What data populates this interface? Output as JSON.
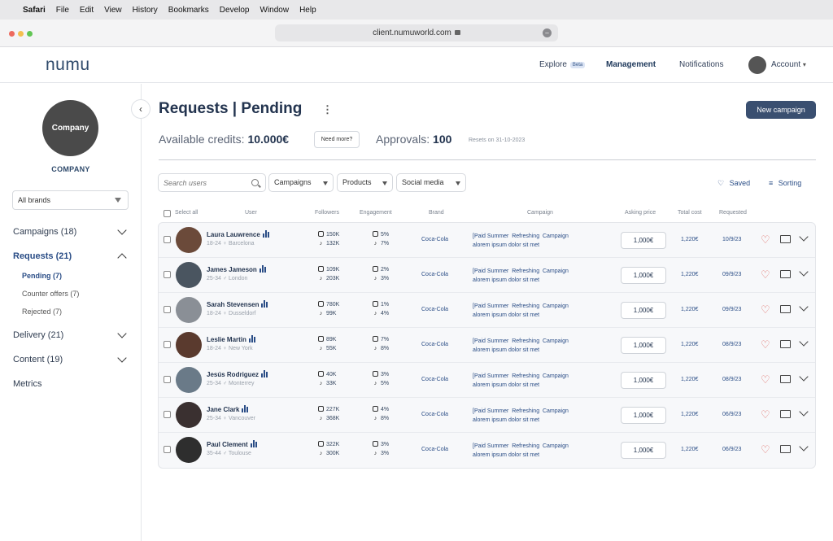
{
  "menubar": {
    "apple": "",
    "app": "Safari",
    "items": [
      "File",
      "Edit",
      "View",
      "History",
      "Bookmarks",
      "Develop",
      "Window",
      "Help"
    ]
  },
  "browser": {
    "url": "client.numuworld.com"
  },
  "topnav": {
    "logo": "numu",
    "explore": "Explore",
    "beta": "Beta",
    "management": "Management",
    "notifications": "Notifications",
    "account": "Account"
  },
  "sidebar": {
    "company_logo": "Company",
    "company_name": "COMPANY",
    "brand_select": "All brands",
    "campaigns": "Campaigns (18)",
    "requests": "Requests (21)",
    "pending": "Pending (7)",
    "counter_offers": "Counter offers (7)",
    "rejected": "Rejected (7)",
    "delivery": "Delivery (21)",
    "content": "Content (19)",
    "metrics": "Metrics"
  },
  "main": {
    "title": "Requests | Pending",
    "new_campaign": "New campaign",
    "credits_label": "Available credits:",
    "credits_value": "10.000€",
    "need_more": "Need more?",
    "approvals_label": "Approvals:",
    "approvals_value": "100",
    "resets": "Resets on 31-10-2023",
    "search_placeholder": "Search users",
    "filters": {
      "campaigns": "Campaigns",
      "products": "Products",
      "social": "Social media"
    },
    "saved": "Saved",
    "sorting": "Sorting"
  },
  "headers": {
    "select_all": "Select all",
    "user": "User",
    "followers": "Followers",
    "engagement": "Engagement",
    "brand": "Brand",
    "campaign": "Campaign",
    "asking_price": "Asking price",
    "total_cost": "Total cost",
    "requested": "Requested"
  },
  "rows": [
    {
      "name": "Laura Lauwrence",
      "meta": "18-24  ♀  Barcelona",
      "ig_f": "150K",
      "tk_f": "132K",
      "ig_e": "5%",
      "tk_e": "7%",
      "brand": "Coca-Cola",
      "camp1": "[Paid Summer  Refreshing  Campaign",
      "camp2": "alorem ipsum dolor sit met",
      "price": "1,000€",
      "total": "1,220€",
      "date": "10/9/23"
    },
    {
      "name": "James Jameson",
      "meta": "25-34  ♂  London",
      "ig_f": "109K",
      "tk_f": "203K",
      "ig_e": "2%",
      "tk_e": "3%",
      "brand": "Coca-Cola",
      "camp1": "[Paid Summer  Refreshing  Campaign",
      "camp2": "alorem ipsum dolor sit met",
      "price": "1,000€",
      "total": "1,220€",
      "date": "09/9/23"
    },
    {
      "name": "Sarah Stevensen",
      "meta": "18-24  ♀  Dusseldorf",
      "ig_f": "780K",
      "tk_f": "99K",
      "ig_e": "1%",
      "tk_e": "4%",
      "brand": "Coca-Cola",
      "camp1": "[Paid Summer  Refreshing  Campaign",
      "camp2": "alorem ipsum dolor sit met",
      "price": "1,000€",
      "total": "1,220€",
      "date": "09/9/23"
    },
    {
      "name": "Leslie Martin",
      "meta": "18-24  ♀  New York",
      "ig_f": "89K",
      "tk_f": "55K",
      "ig_e": "7%",
      "tk_e": "8%",
      "brand": "Coca-Cola",
      "camp1": "[Paid Summer  Refreshing  Campaign",
      "camp2": "alorem ipsum dolor sit met",
      "price": "1,000€",
      "total": "1,220€",
      "date": "08/9/23"
    },
    {
      "name": "Jesús Rodriguez",
      "meta": "25-34  ♂  Monterrey",
      "ig_f": "40K",
      "tk_f": "33K",
      "ig_e": "3%",
      "tk_e": "5%",
      "brand": "Coca-Cola",
      "camp1": "[Paid Summer  Refreshing  Campaign",
      "camp2": "alorem ipsum dolor sit met",
      "price": "1,000€",
      "total": "1,220€",
      "date": "08/9/23"
    },
    {
      "name": "Jane Clark",
      "meta": "25-34  ♀  Vancouver",
      "ig_f": "227K",
      "tk_f": "368K",
      "ig_e": "4%",
      "tk_e": "8%",
      "brand": "Coca-Cola",
      "camp1": "[Paid Summer  Refreshing  Campaign",
      "camp2": "alorem ipsum dolor sit met",
      "price": "1,000€",
      "total": "1,220€",
      "date": "06/9/23"
    },
    {
      "name": "Paul Clement",
      "meta": "35-44  ♂  Toulouse",
      "ig_f": "322K",
      "tk_f": "300K",
      "ig_e": "3%",
      "tk_e": "3%",
      "brand": "Coca-Cola",
      "camp1": "[Paid Summer  Refreshing  Campaign",
      "camp2": "alorem ipsum dolor sit met",
      "price": "1,000€",
      "total": "1,220€",
      "date": "06/9/23"
    }
  ],
  "colors": {
    "accent": "#2a4d86",
    "button": "#3a4f70",
    "heart": "#e0706a"
  }
}
